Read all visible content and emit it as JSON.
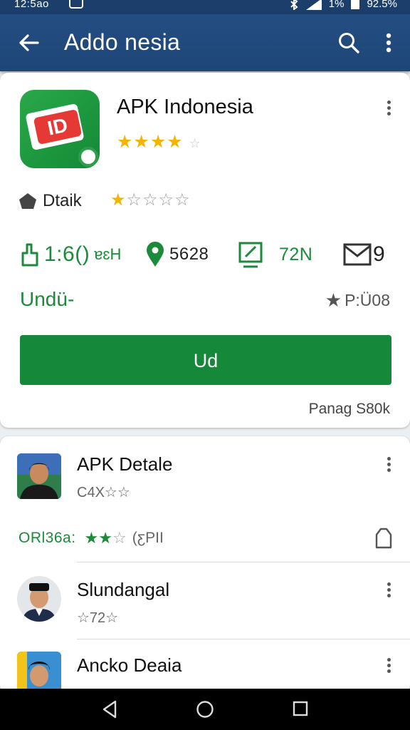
{
  "status_bar": {
    "time": "12:5ao",
    "battery": "92.5%",
    "signal_level": "1%"
  },
  "app_bar": {
    "title": "Addo nesia",
    "icons": [
      "back-arrow-icon",
      "search-icon",
      "more-vert-icon"
    ]
  },
  "app_card": {
    "icon_text": "ID",
    "name": "APK Indonesia",
    "rating_stars": "★★★★",
    "rating_tail": "☆",
    "tag_label": "Dtaik",
    "tag_stars_on": "★",
    "tag_stars_off": "☆☆☆☆",
    "stats": [
      {
        "icon": "thumb-icon",
        "value": "1:6()",
        "unit": "ɐɛH"
      },
      {
        "icon": "location-pin-icon",
        "value": "5628"
      },
      {
        "icon": "device-icon",
        "value": "72N"
      },
      {
        "icon": "mail-icon",
        "value": "9"
      }
    ],
    "download_label": "Undü-",
    "score": "P:Ü08",
    "primary_button": "Ud",
    "footnote": "Panag S80k"
  },
  "list": [
    {
      "title": "APK Detale",
      "subtitle": "C4X☆☆"
    },
    {
      "title": "Slundangal",
      "subtitle": "☆72☆"
    },
    {
      "title": "Ancko Deaia"
    }
  ],
  "offer": {
    "label": "ORl36a:",
    "stars_on": "★★",
    "stars_off": "☆",
    "meta": "(ƹPII"
  },
  "colors": {
    "primary": "#15883a",
    "appbar": "#1e4677",
    "star": "#f4b400"
  }
}
